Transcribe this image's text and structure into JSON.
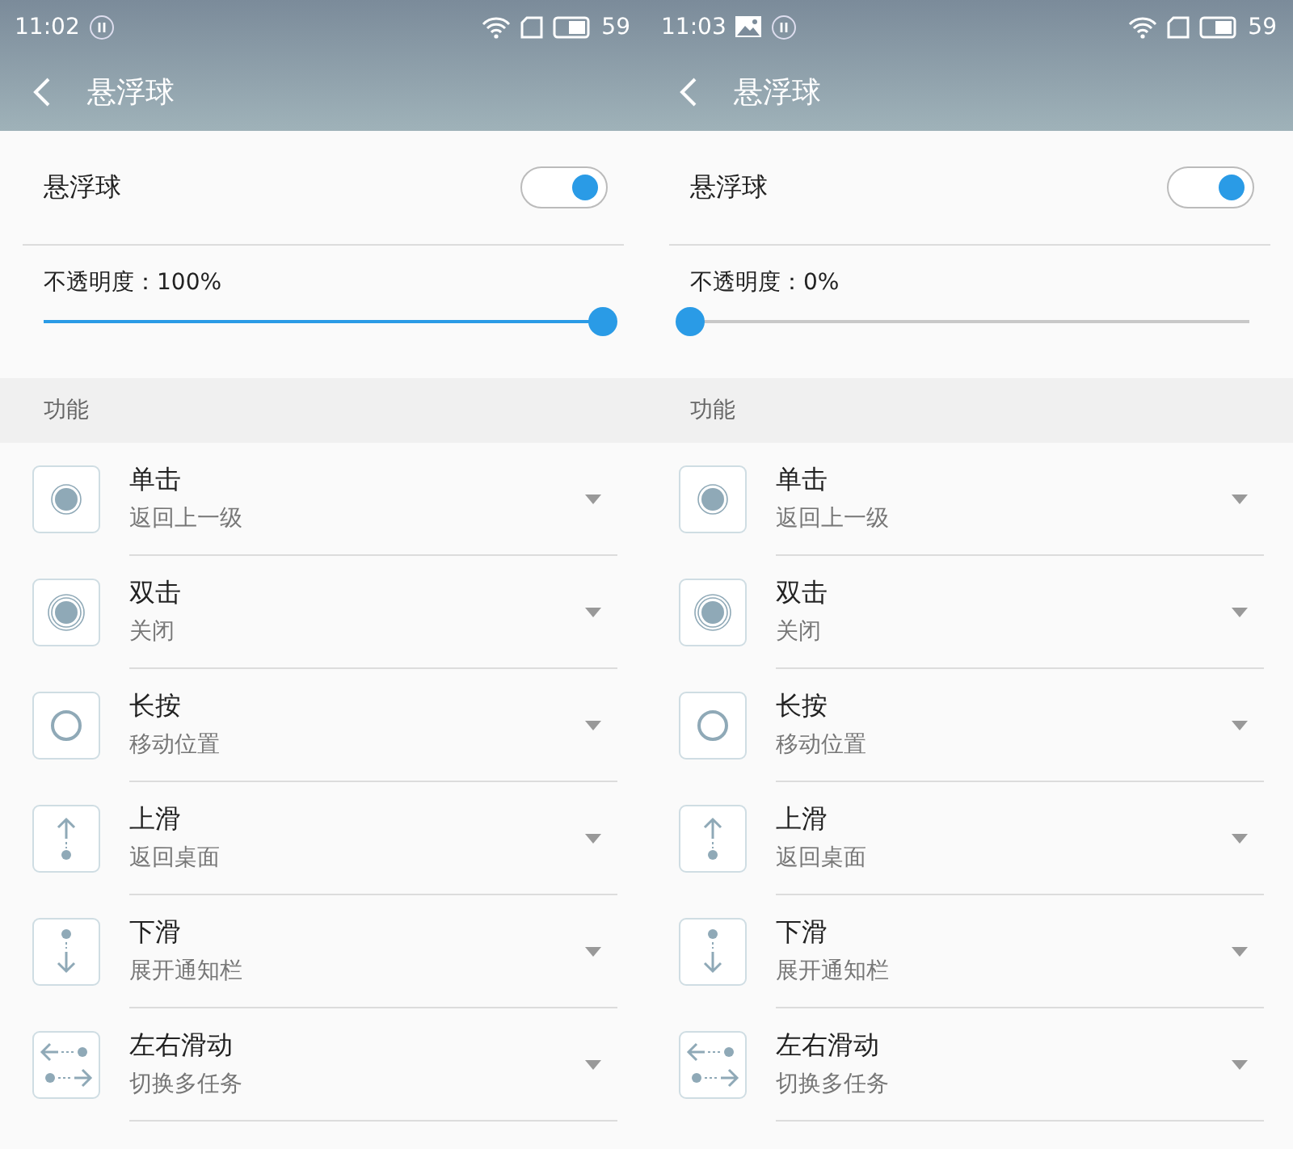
{
  "phones": [
    {
      "status_bar": {
        "time": "11:02",
        "notifications": [
          {
            "kind": "pause"
          }
        ],
        "battery": "59"
      },
      "header": {
        "title": "悬浮球"
      },
      "toggle": {
        "label": "悬浮球",
        "on": true
      },
      "opacity": {
        "reading": "不透明度：100%",
        "level": 1
      },
      "section": {
        "title": "功能"
      },
      "actions": [
        {
          "kind": "tap",
          "name": "单击",
          "value": "返回上一级"
        },
        {
          "kind": "double_tap",
          "name": "双击",
          "value": "关闭"
        },
        {
          "kind": "long_press",
          "name": "长按",
          "value": "移动位置"
        },
        {
          "kind": "swipe_up",
          "name": "上滑",
          "value": "返回桌面"
        },
        {
          "kind": "swipe_down",
          "name": "下滑",
          "value": "展开通知栏"
        },
        {
          "kind": "swipe_sideways",
          "name": "左右滑动",
          "value": "切换多任务"
        }
      ]
    },
    {
      "status_bar": {
        "time": "11:03",
        "notifications": [
          {
            "kind": "picture"
          },
          {
            "kind": "pause"
          }
        ],
        "battery": "59"
      },
      "header": {
        "title": "悬浮球"
      },
      "toggle": {
        "label": "悬浮球",
        "on": true
      },
      "opacity": {
        "reading": "不透明度：0%",
        "level": 0
      },
      "section": {
        "title": "功能"
      },
      "actions": [
        {
          "kind": "tap",
          "name": "单击",
          "value": "返回上一级"
        },
        {
          "kind": "double_tap",
          "name": "双击",
          "value": "关闭"
        },
        {
          "kind": "long_press",
          "name": "长按",
          "value": "移动位置"
        },
        {
          "kind": "swipe_up",
          "name": "上滑",
          "value": "返回桌面"
        },
        {
          "kind": "swipe_down",
          "name": "下滑",
          "value": "展开通知栏"
        },
        {
          "kind": "swipe_sideways",
          "name": "左右滑动",
          "value": "切换多任务"
        }
      ]
    }
  ]
}
